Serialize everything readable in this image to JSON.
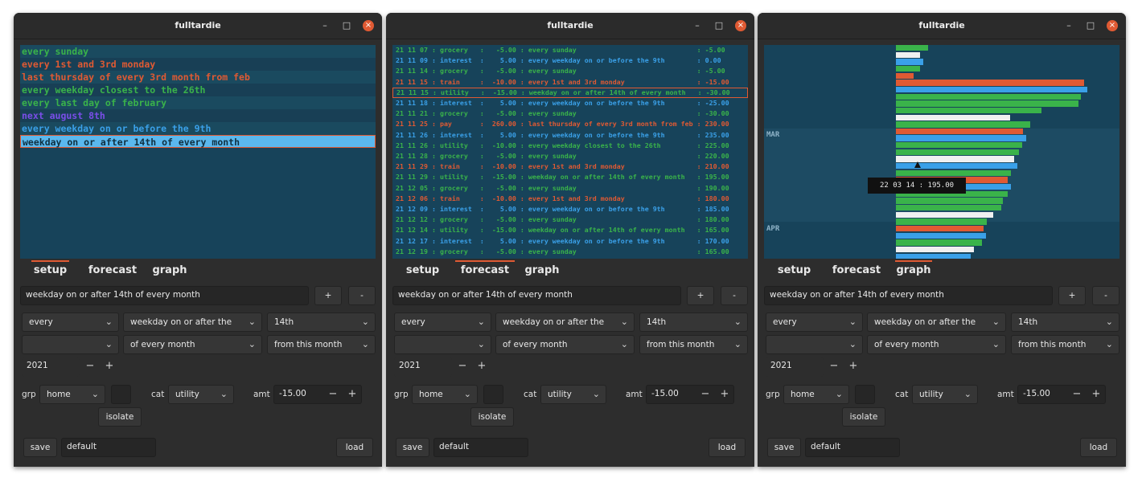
{
  "windows": [
    {
      "title": "fulltardie",
      "active_tab": 0
    },
    {
      "title": "fulltardie",
      "active_tab": 1
    },
    {
      "title": "fulltardie",
      "active_tab": 2
    }
  ],
  "tabs": [
    "setup",
    "forecast",
    "graph"
  ],
  "colors": {
    "green": "#3ab34a",
    "orange": "#e05a33",
    "blue": "#3aa0e8",
    "purple": "#7a4ee8",
    "white": "#f0f0f0",
    "panel_bg": "#17435a"
  },
  "setup_rules": [
    {
      "text": "every sunday",
      "color": "green"
    },
    {
      "text": "every 1st and 3rd monday",
      "color": "orange"
    },
    {
      "text": "last thursday of every 3rd month from feb",
      "color": "orange"
    },
    {
      "text": "every weekday closest to the 26th",
      "color": "green"
    },
    {
      "text": "every last day of february",
      "color": "green"
    },
    {
      "text": "next august 8th",
      "color": "purple"
    },
    {
      "text": "every weekday on or before the 9th",
      "color": "blue"
    },
    {
      "text": "weekday on or after 14th of every month",
      "color": "selected"
    }
  ],
  "forecast_lines": [
    {
      "text": "21 11 07 : grocery   :   -5.00 : every sunday                              : -5.00",
      "color": "green"
    },
    {
      "text": "21 11 09 : interest  :    5.00 : every weekday on or before the 9th        : 0.00",
      "color": "blue"
    },
    {
      "text": "21 11 14 : grocery   :   -5.00 : every sunday                              : -5.00",
      "color": "green"
    },
    {
      "text": "21 11 15 : train     :  -10.00 : every 1st and 3rd monday                  : -15.00",
      "color": "orange"
    },
    {
      "text": "21 11 15 : utility   :  -15.00 : weekday on or after 14th of every month   : -30.00",
      "color": "green",
      "selected": true
    },
    {
      "text": "21 11 18 : interest  :    5.00 : every weekday on or before the 9th        : -25.00",
      "color": "blue"
    },
    {
      "text": "21 11 21 : grocery   :   -5.00 : every sunday                              : -30.00",
      "color": "green"
    },
    {
      "text": "21 11 25 : pay       :  260.00 : last thursday of every 3rd month from feb : 230.00",
      "color": "orange"
    },
    {
      "text": "21 11 26 : interest  :    5.00 : every weekday on or before the 9th        : 235.00",
      "color": "blue"
    },
    {
      "text": "21 11 26 : utility   :  -10.00 : every weekday closest to the 26th         : 225.00",
      "color": "green"
    },
    {
      "text": "21 11 28 : grocery   :   -5.00 : every sunday                              : 220.00",
      "color": "green"
    },
    {
      "text": "21 11 29 : train     :  -10.00 : every 1st and 3rd monday                  : 210.00",
      "color": "orange"
    },
    {
      "text": "21 11 29 : utility   :  -15.00 : weekday on or after 14th of every month   : 195.00",
      "color": "green"
    },
    {
      "text": "21 12 05 : grocery   :   -5.00 : every sunday                              : 190.00",
      "color": "green"
    },
    {
      "text": "21 12 06 : train     :  -10.00 : every 1st and 3rd monday                  : 180.00",
      "color": "orange"
    },
    {
      "text": "21 12 09 : interest  :    5.00 : every weekday on or before the 9th        : 185.00",
      "color": "blue"
    },
    {
      "text": "21 12 12 : grocery   :   -5.00 : every sunday                              : 180.00",
      "color": "green"
    },
    {
      "text": "21 12 14 : utility   :  -15.00 : weekday on or after 14th of every month   : 165.00",
      "color": "green"
    },
    {
      "text": "21 12 17 : interest  :    5.00 : every weekday on or before the 9th        : 170.00",
      "color": "blue"
    },
    {
      "text": "21 12 19 : grocery   :   -5.00 : every sunday                              : 165.00",
      "color": "green"
    }
  ],
  "graph": {
    "month_labels": [
      "MAR",
      "APR"
    ],
    "tooltip": "22 03 14 : 195.00",
    "bars": [
      {
        "value": 40,
        "color": "green"
      },
      {
        "value": 30,
        "color": "white"
      },
      {
        "value": 34,
        "color": "blue"
      },
      {
        "value": 30,
        "color": "green"
      },
      {
        "value": 22,
        "color": "orange"
      },
      {
        "value": 234,
        "color": "orange"
      },
      {
        "value": 238,
        "color": "blue"
      },
      {
        "value": 230,
        "color": "green"
      },
      {
        "value": 227,
        "color": "green"
      },
      {
        "value": 181,
        "color": "green"
      },
      {
        "value": 142,
        "color": "white"
      },
      {
        "value": 167,
        "color": "green"
      },
      {
        "value": 158,
        "color": "orange"
      },
      {
        "value": 162,
        "color": "blue"
      },
      {
        "value": 157,
        "color": "green"
      },
      {
        "value": 153,
        "color": "green"
      },
      {
        "value": 147,
        "color": "white"
      },
      {
        "value": 151,
        "color": "blue"
      },
      {
        "value": 143,
        "color": "green"
      },
      {
        "value": 139,
        "color": "orange"
      },
      {
        "value": 143,
        "color": "blue"
      },
      {
        "value": 139,
        "color": "green"
      },
      {
        "value": 133,
        "color": "green"
      },
      {
        "value": 131,
        "color": "green"
      },
      {
        "value": 121,
        "color": "white"
      },
      {
        "value": 113,
        "color": "green"
      },
      {
        "value": 109,
        "color": "orange"
      },
      {
        "value": 112,
        "color": "blue"
      },
      {
        "value": 107,
        "color": "green"
      },
      {
        "value": 97,
        "color": "white"
      },
      {
        "value": 93,
        "color": "blue"
      }
    ]
  },
  "form": {
    "rule_text": "weekday on or after 14th of every month",
    "add_label": "+",
    "remove_label": "-",
    "combo_row1": [
      "every",
      "weekday on or after the",
      "14th"
    ],
    "combo_row2": [
      "",
      "of every month",
      "from this month"
    ],
    "year": "2021",
    "minus_label": "−",
    "plus_label": "+",
    "grp_label": "grp",
    "grp_value": "home",
    "cat_label": "cat",
    "cat_value": "utility",
    "amt_label": "amt",
    "amt_value": "-15.00",
    "isolate_label": "isolate",
    "save_label": "save",
    "filename": "default",
    "load_label": "load"
  }
}
